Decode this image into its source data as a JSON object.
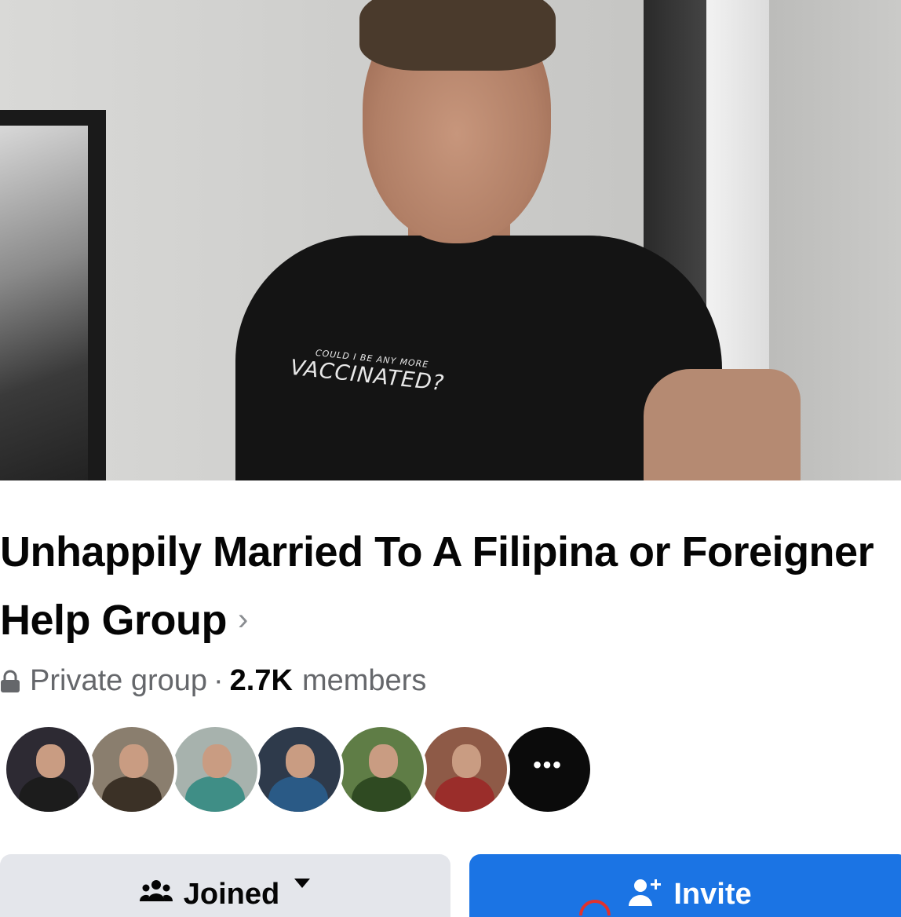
{
  "cover": {
    "shirt_text_small": "COULD I BE ANY MORE",
    "shirt_text_big": "VACCINATED?"
  },
  "group": {
    "title": "Unhappily Married To A Filipina or Foreigner Help Group",
    "chevron": "›",
    "privacy": "Private group",
    "separator": "·",
    "member_count": "2.7K",
    "member_label": "members"
  },
  "members": {
    "avatars": [
      {
        "bg": "#2d2a33",
        "body": "#1c1c1c"
      },
      {
        "bg": "#8a7e6e",
        "body": "#3b3126"
      },
      {
        "bg": "#a7b2ad",
        "body": "#3f8e86"
      },
      {
        "bg": "#2e3a4b",
        "body": "#2a5a86"
      },
      {
        "bg": "#5f7d46",
        "body": "#2f4a22"
      },
      {
        "bg": "#8e5a47",
        "body": "#9a2d2a"
      }
    ],
    "more_label": "•••"
  },
  "actions": {
    "joined_label": "Joined",
    "invite_label": "Invite"
  },
  "colors": {
    "primary": "#1b74e4",
    "secondary_button": "#e4e6eb",
    "text": "#050505",
    "muted": "#65676b"
  }
}
